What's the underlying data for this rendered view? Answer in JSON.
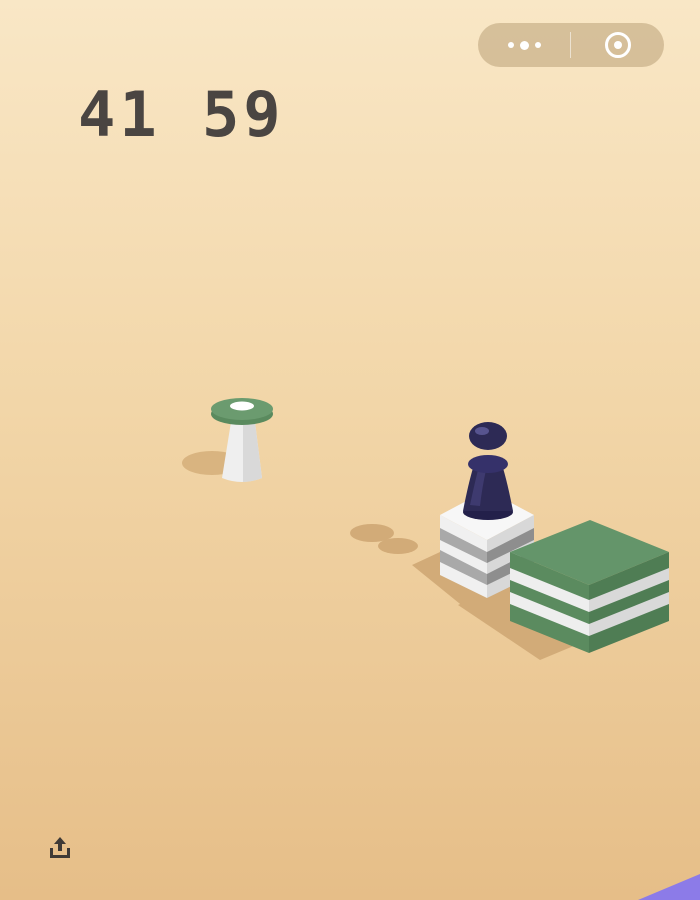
{
  "score": "41 59",
  "top_bar": {
    "more_icon": "three-dots-icon",
    "close_icon": "target-circle-icon"
  },
  "share_icon": "share-upload-icon",
  "colors": {
    "background_top": "#f9e7c6",
    "background_bottom": "#e6be88",
    "score_text": "#4a4542",
    "block_green": "#64956a",
    "block_white": "#f2f2f2",
    "stripe_gray": "#a9a9a9",
    "player": "#2d2a55",
    "corner_accent": "#8c7be8"
  }
}
